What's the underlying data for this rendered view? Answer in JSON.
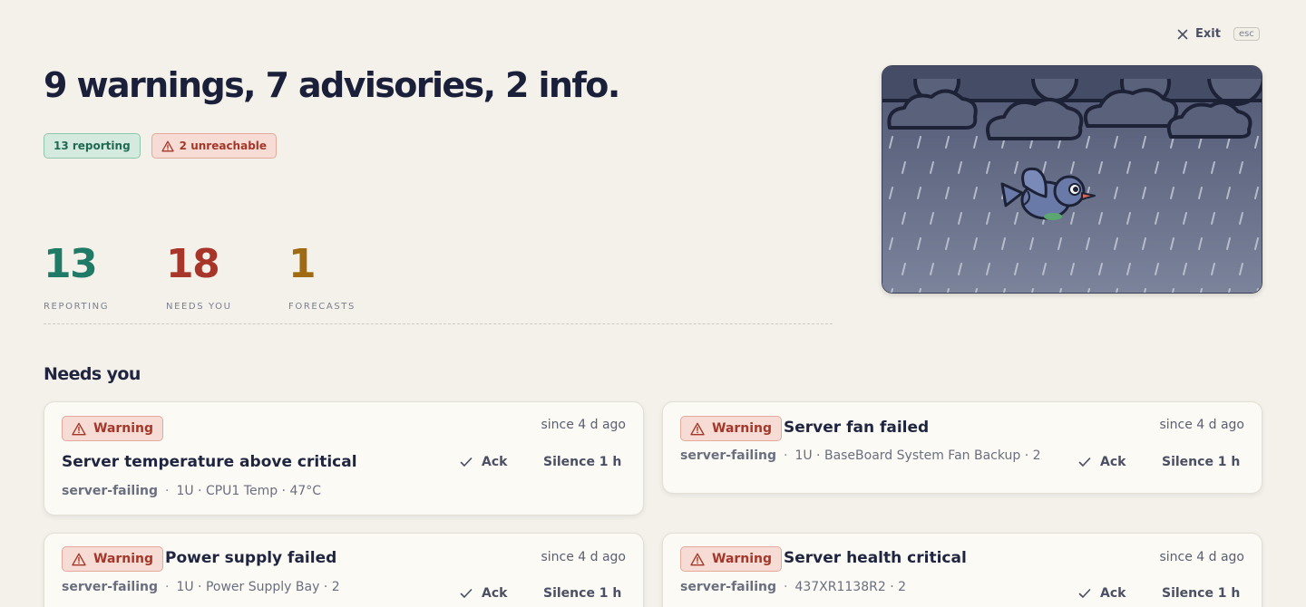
{
  "exit": {
    "label": "Exit",
    "key": "esc"
  },
  "summary": {
    "title": "9 warnings, 7 advisories, 2 info.",
    "reporting_pill": "13 reporting",
    "unreachable_pill": "2 unreachable"
  },
  "stats": [
    {
      "value": "13",
      "label": "REPORTING",
      "color": "#1f7a66"
    },
    {
      "value": "18",
      "label": "NEEDS YOU",
      "color": "#a8352a"
    },
    {
      "value": "1",
      "label": "FORECASTS",
      "color": "#a06a12"
    }
  ],
  "section": {
    "title": "Needs you"
  },
  "alerts": [
    {
      "severity": "Warning",
      "title": "Server temperature above critical",
      "since": "since 4 d ago",
      "source": "server-failing",
      "detail": "1U · CPU1 Temp · 47°C",
      "ack": "Ack",
      "silence": "Silence 1 h"
    },
    {
      "severity": "Warning",
      "title": "Server fan failed",
      "since": "since 4 d ago",
      "source": "server-failing",
      "detail": "1U · BaseBoard System Fan Backup · 2",
      "ack": "Ack",
      "silence": "Silence 1 h"
    },
    {
      "severity": "Warning",
      "title": "Power supply failed",
      "since": "since 4 d ago",
      "source": "server-failing",
      "detail": "1U · Power Supply Bay · 2",
      "ack": "Ack",
      "silence": "Silence 1 h"
    },
    {
      "severity": "Warning",
      "title": "Server health critical",
      "since": "since 4 d ago",
      "source": "server-failing",
      "detail": "437XR1138R2 · 2",
      "ack": "Ack",
      "silence": "Silence 1 h"
    }
  ],
  "colors": {
    "background": "#f4f1ea",
    "warning_bg": "#f6dcd4",
    "warning_text": "#a5372a",
    "ok_bg": "#d5eadf",
    "ok_text": "#1f6a53"
  },
  "icons": {
    "exit": "close-icon",
    "warning": "warning-triangle-icon",
    "ack": "check-icon",
    "scene": "rain-cloud-bird-illustration"
  }
}
